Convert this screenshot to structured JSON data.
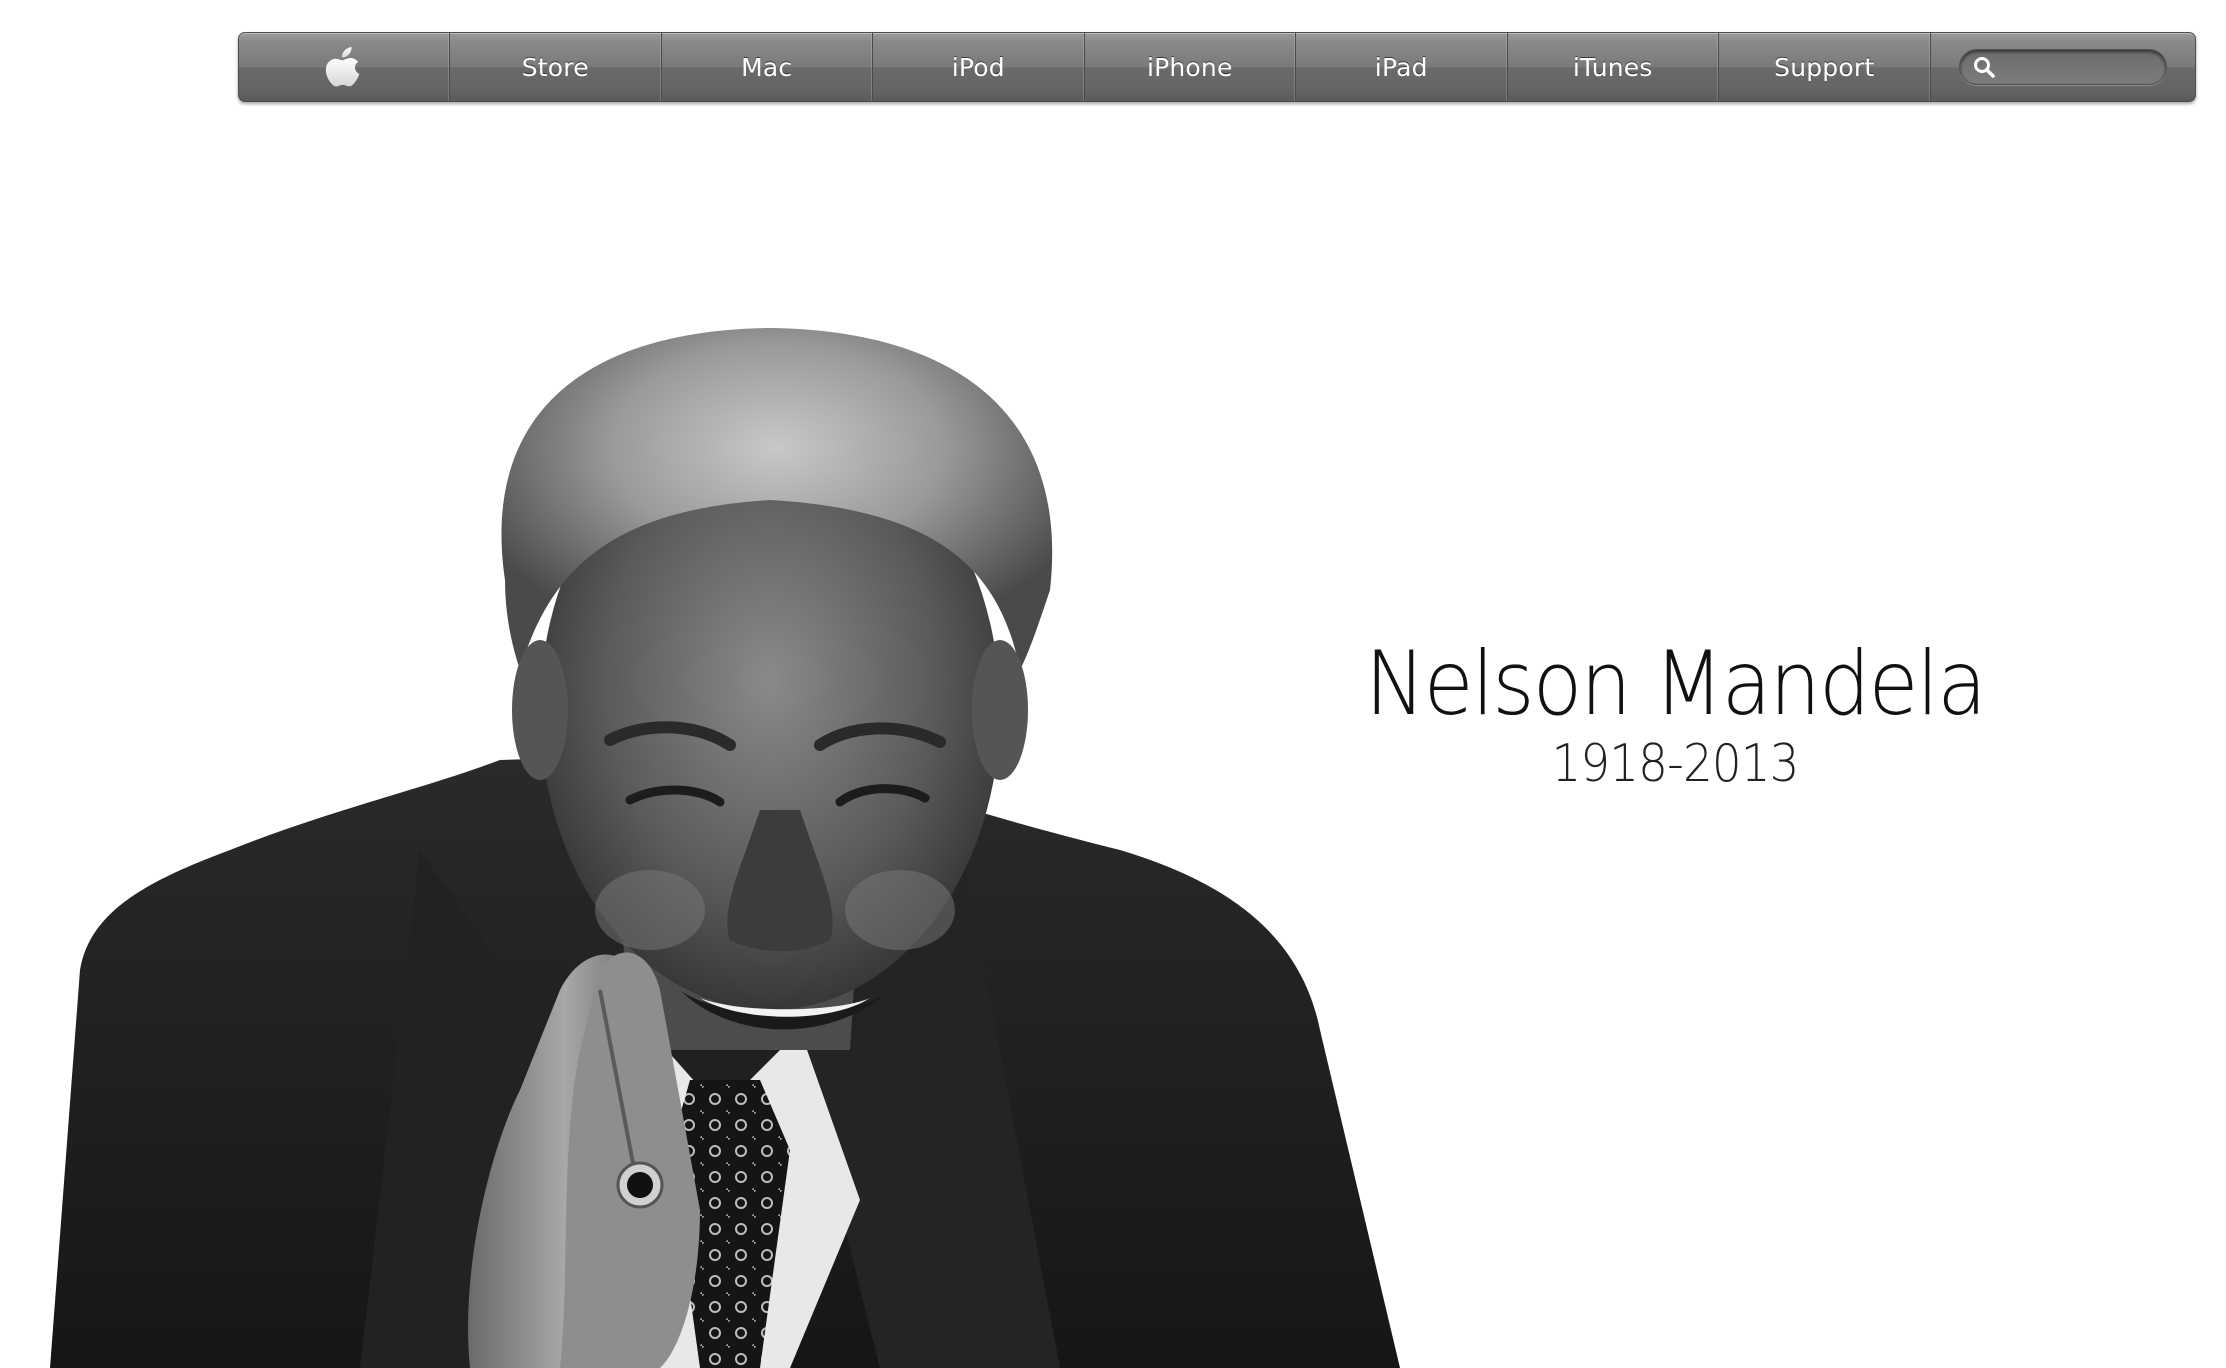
{
  "nav": {
    "logo_icon": "apple-logo-icon",
    "items": [
      {
        "label": "Store"
      },
      {
        "label": "Mac"
      },
      {
        "label": "iPod"
      },
      {
        "label": "iPhone"
      },
      {
        "label": "iPad"
      },
      {
        "label": "iTunes"
      },
      {
        "label": "Support"
      }
    ],
    "search": {
      "icon": "search-icon",
      "placeholder": "",
      "value": ""
    }
  },
  "hero": {
    "title": "Nelson Mandela",
    "years": "1918-2013",
    "photo_icon": "portrait-photo"
  },
  "colors": {
    "nav_gradient_top": "#9b9b9b",
    "nav_gradient_bottom": "#5a5a5a",
    "background": "#ffffff",
    "text": "#111111"
  }
}
